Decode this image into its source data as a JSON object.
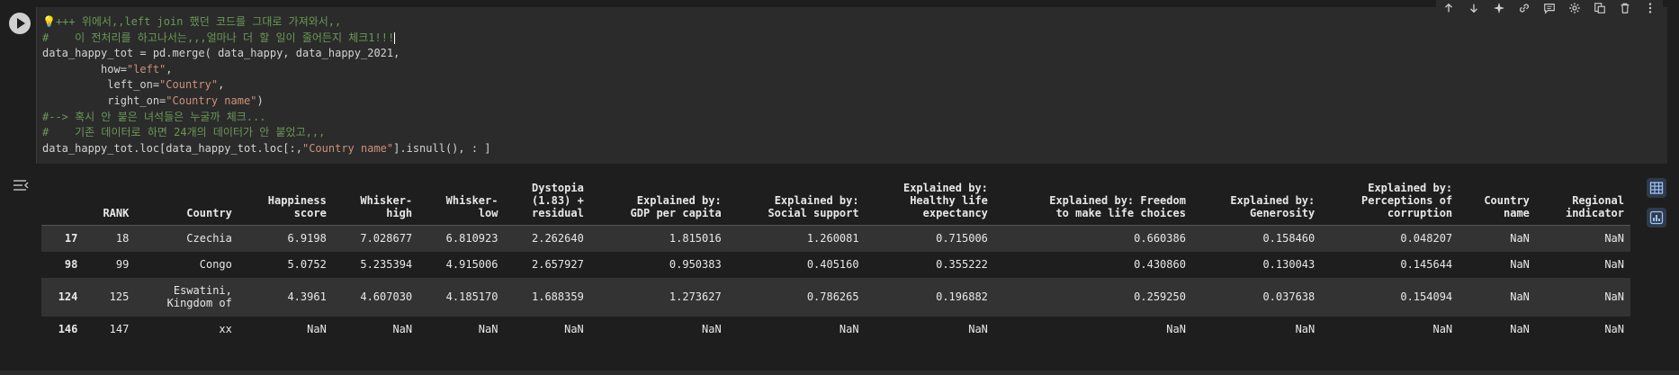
{
  "code": {
    "lines": [
      [
        {
          "t": "💡+++ 위에서,,left join 했던 코드를 그대로 가져와서,,",
          "c": "com"
        }
      ],
      [
        {
          "t": "#    이 전처리를 하고나서는,,,얼마나 더 할 일이 줄어든지 체크1!!!",
          "c": "com"
        },
        {
          "t": "|",
          "c": "cursor"
        }
      ],
      [
        {
          "t": "data_happy_tot = pd.merge( data_happy, data_happy_2021,",
          "c": "plain"
        }
      ],
      [
        {
          "t": "         how=",
          "c": "plain"
        },
        {
          "t": "\"left\"",
          "c": "str"
        },
        {
          "t": ",",
          "c": "plain"
        }
      ],
      [
        {
          "t": "          left_on=",
          "c": "plain"
        },
        {
          "t": "\"Country\"",
          "c": "str"
        },
        {
          "t": ",",
          "c": "plain"
        }
      ],
      [
        {
          "t": "          right_on=",
          "c": "plain"
        },
        {
          "t": "\"Country name\"",
          "c": "str"
        },
        {
          "t": ")",
          "c": "plain"
        }
      ],
      [
        {
          "t": "#--> 혹시 안 붙은 녀석들은 누굴까 체크...",
          "c": "com"
        }
      ],
      [
        {
          "t": "#    기존 데이터로 하면 24개의 데이터가 안 붙었고,,,",
          "c": "com"
        }
      ],
      [
        {
          "t": "data_happy_tot.loc[data_happy_tot.loc[:,",
          "c": "plain"
        },
        {
          "t": "\"Country name\"",
          "c": "str"
        },
        {
          "t": "].isnull(), : ]",
          "c": "plain"
        }
      ]
    ]
  },
  "toolbar": {
    "icons": [
      "arrow-up-icon",
      "arrow-down-icon",
      "sparkle-icon",
      "link-icon",
      "comment-icon",
      "gear-icon",
      "mirror-cell-icon",
      "trash-icon",
      "more-vert-icon"
    ]
  },
  "table": {
    "headers": [
      "",
      "RANK",
      "Country",
      "Happiness\nscore",
      "Whisker-\nhigh",
      "Whisker-\nlow",
      "Dystopia\n(1.83) +\nresidual",
      "Explained by:\nGDP per capita",
      "Explained by:\nSocial support",
      "Explained by:\nHealthy life\nexpectancy",
      "Explained by: Freedom\nto make life choices",
      "Explained by:\nGenerosity",
      "Explained by:\nPerceptions of\ncorruption",
      "Country\nname",
      "Regional\nindicator"
    ],
    "rows": [
      [
        "17",
        "18",
        "Czechia",
        "6.9198",
        "7.028677",
        "6.810923",
        "2.262640",
        "1.815016",
        "1.260081",
        "0.715006",
        "0.660386",
        "0.158460",
        "0.048207",
        "NaN",
        "NaN"
      ],
      [
        "98",
        "99",
        "Congo",
        "5.0752",
        "5.235394",
        "4.915006",
        "2.657927",
        "0.950383",
        "0.405160",
        "0.355222",
        "0.430860",
        "0.130043",
        "0.145644",
        "NaN",
        "NaN"
      ],
      [
        "124",
        "125",
        "Eswatini,\nKingdom of",
        "4.3961",
        "4.607030",
        "4.185170",
        "1.688359",
        "1.273627",
        "0.786265",
        "0.196882",
        "0.259250",
        "0.037638",
        "0.154094",
        "NaN",
        "NaN"
      ],
      [
        "146",
        "147",
        "xx",
        "NaN",
        "NaN",
        "NaN",
        "NaN",
        "NaN",
        "NaN",
        "NaN",
        "NaN",
        "NaN",
        "NaN",
        "NaN",
        "NaN"
      ]
    ]
  },
  "colors": {
    "comment": "#6a9955",
    "string": "#ce9178",
    "background": "#1e1e1e",
    "cell": "#2b2b2b"
  }
}
